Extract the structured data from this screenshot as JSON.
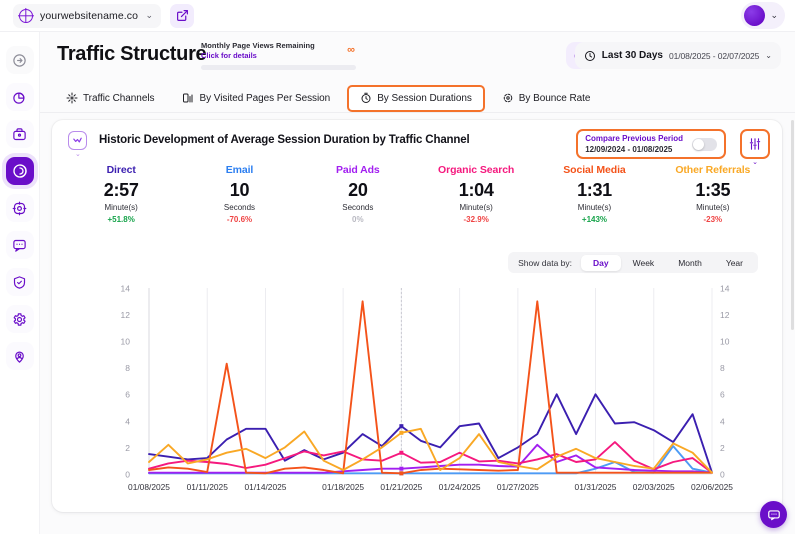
{
  "topbar": {
    "site_name": "yourwebsitename.co",
    "site_chevron": "⌄",
    "avatar_chevron": "⌄"
  },
  "sidebar": {
    "items": [
      {
        "name": "expand-panel",
        "icon": "arrow-right-circle-icon"
      },
      {
        "name": "dashboard",
        "icon": "pie-chart-icon"
      },
      {
        "name": "campaigns",
        "icon": "briefcase-icon"
      },
      {
        "name": "traffic",
        "icon": "traffic-icon",
        "active": true
      },
      {
        "name": "goals",
        "icon": "target-icon"
      },
      {
        "name": "messages",
        "icon": "chat-icon"
      },
      {
        "name": "security",
        "icon": "shield-check-icon"
      },
      {
        "name": "settings",
        "icon": "gear-icon"
      },
      {
        "name": "visitors",
        "icon": "user-location-icon"
      }
    ]
  },
  "header": {
    "title": "Traffic Structure",
    "quota_label": "Monthly Page Views Remaining",
    "quota_link": "Click for details",
    "quota_value": "∞",
    "refresh_icon": "refresh-icon",
    "date_icon": "clock-icon",
    "date_label": "Last 30 Days",
    "date_range": "01/08/2025 - 02/07/2025",
    "date_chevron": "⌄"
  },
  "tabs": [
    {
      "label": "Traffic Channels",
      "icon": "share-nodes-icon",
      "active": false
    },
    {
      "label": "By Visited Pages Per Session",
      "icon": "pages-icon",
      "active": false
    },
    {
      "label": "By Session Durations",
      "icon": "stopwatch-icon",
      "active": true,
      "highlighted": true
    },
    {
      "label": "By Bounce Rate",
      "icon": "bounce-icon",
      "active": false
    }
  ],
  "card": {
    "icon": "chart-box-icon",
    "icon_chevron": "⌄",
    "title": "Historic Development of Average Session Duration by Traffic Channel",
    "compare": {
      "label": "Compare Previous Period",
      "range": "12/09/2024 - 01/08/2025",
      "toggle_on": false
    },
    "filter_icon": "sliders-icon",
    "filter_chevron": "⌄"
  },
  "metrics": [
    {
      "name": "Direct",
      "value": "2:57",
      "unit": "Minute(s)",
      "delta": "+51.8%",
      "delta_dir": "up",
      "color": "#3b1fb0",
      "delta_color": "#16a34a"
    },
    {
      "name": "Email",
      "value": "10",
      "unit": "Seconds",
      "delta": "-70.6%",
      "delta_dir": "down",
      "color": "#2b7ef0",
      "delta_color": "#ef4444"
    },
    {
      "name": "Paid Ads",
      "value": "20",
      "unit": "Seconds",
      "delta": "0%",
      "delta_dir": "flat",
      "color": "#a21ff0",
      "delta_color": "#b9b9c2"
    },
    {
      "name": "Organic Search",
      "value": "1:04",
      "unit": "Minute(s)",
      "delta": "-32.9%",
      "delta_dir": "down",
      "color": "#f5197e",
      "delta_color": "#ef4444"
    },
    {
      "name": "Social Media",
      "value": "1:31",
      "unit": "Minute(s)",
      "delta": "+143%",
      "delta_dir": "up",
      "color": "#f4531a",
      "delta_color": "#16a34a"
    },
    {
      "name": "Other Referrals",
      "value": "1:35",
      "unit": "Minute(s)",
      "delta": "-23%",
      "delta_dir": "down",
      "color": "#f9a825",
      "delta_color": "#ef4444"
    }
  ],
  "showby": {
    "label": "Show data by:",
    "options": [
      "Day",
      "Week",
      "Month",
      "Year"
    ],
    "selected": "Day"
  },
  "chart_data": {
    "type": "line",
    "title": "Historic Development of Average Session Duration by Traffic Channel",
    "xlabel": "",
    "ylabel": "",
    "ylim": [
      0,
      14
    ],
    "yticks": [
      0,
      2,
      4,
      6,
      8,
      10,
      12,
      14
    ],
    "grid": "vertical-only",
    "legend": "top-metrics",
    "x": [
      "01/08/2025",
      "01/09/2025",
      "01/10/2025",
      "01/11/2025",
      "01/12/2025",
      "01/13/2025",
      "01/14/2025",
      "01/15/2025",
      "01/16/2025",
      "01/17/2025",
      "01/18/2025",
      "01/19/2025",
      "01/20/2025",
      "01/21/2025",
      "01/22/2025",
      "01/23/2025",
      "01/24/2025",
      "01/25/2025",
      "01/26/2025",
      "01/27/2025",
      "01/28/2025",
      "01/29/2025",
      "01/30/2025",
      "01/31/2025",
      "02/01/2025",
      "02/02/2025",
      "02/03/2025",
      "02/04/2025",
      "02/05/2025",
      "02/06/2025"
    ],
    "xtick_labels": [
      "01/08/2025",
      "01/11/2025",
      "01/14/2025",
      "01/18/2025",
      "01/21/2025",
      "01/24/2025",
      "01/27/2025",
      "01/31/2025",
      "02/03/2025",
      "02/06/2025"
    ],
    "series": [
      {
        "name": "Direct",
        "color": "#3b1fb0",
        "values": [
          1.5,
          1.3,
          1.1,
          1.2,
          2.6,
          3.4,
          3.4,
          1.0,
          1.8,
          1.1,
          1.6,
          3.0,
          2.1,
          3.6,
          2.5,
          2.0,
          3.6,
          3.8,
          1.2,
          2.0,
          3.0,
          6.0,
          3.0,
          6.0,
          3.8,
          3.9,
          3.3,
          2.4,
          4.5,
          0.1
        ]
      },
      {
        "name": "Email",
        "color": "#4d9bf5",
        "values": [
          0.05,
          0.05,
          0.05,
          0.05,
          0.05,
          0.05,
          0.05,
          0.05,
          0.05,
          0.05,
          0.05,
          0.05,
          0.05,
          0.05,
          0.05,
          0.05,
          0.05,
          0.05,
          0.05,
          0.05,
          0.05,
          0.05,
          0.05,
          0.4,
          0.9,
          0.15,
          0.1,
          2.1,
          0.4,
          0.1
        ]
      },
      {
        "name": "Paid Ads",
        "color": "#a21ff0",
        "values": [
          0.1,
          0.1,
          0.1,
          0.1,
          0.1,
          0.1,
          0.1,
          0.1,
          0.1,
          0.1,
          0.2,
          0.3,
          0.4,
          0.4,
          0.5,
          0.6,
          0.7,
          0.7,
          0.6,
          0.55,
          2.2,
          0.9,
          1.4,
          0.5,
          0.4,
          0.3,
          0.25,
          0.2,
          0.2,
          0.1
        ]
      },
      {
        "name": "Organic Search",
        "color": "#f5197e",
        "values": [
          0.4,
          0.8,
          1.0,
          0.9,
          0.75,
          0.45,
          0.7,
          1.2,
          1.7,
          1.4,
          1.7,
          1.1,
          1.0,
          1.6,
          0.85,
          0.9,
          1.6,
          0.95,
          1.0,
          0.8,
          1.1,
          1.5,
          0.9,
          1.1,
          2.4,
          1.0,
          0.35,
          0.9,
          1.2,
          0.1
        ]
      },
      {
        "name": "Social Media",
        "color": "#f4531a",
        "values": [
          0.3,
          0.5,
          0.4,
          0.15,
          8.3,
          0.1,
          0.05,
          0.4,
          0.5,
          0.3,
          0.05,
          13.0,
          0.1,
          0.05,
          0.3,
          0.4,
          0.35,
          0.3,
          0.25,
          0.3,
          13.0,
          0.1,
          0.1,
          0.1,
          0.1,
          0.1,
          0.1,
          0.1,
          0.1,
          0.1
        ]
      },
      {
        "name": "Other Referrals",
        "color": "#f9a825",
        "values": [
          0.9,
          2.2,
          0.8,
          1.1,
          1.6,
          1.9,
          1.2,
          2.0,
          3.2,
          1.0,
          0.3,
          1.1,
          2.0,
          3.1,
          3.4,
          0.3,
          1.2,
          3.0,
          0.9,
          0.6,
          0.35,
          1.3,
          1.9,
          1.2,
          0.9,
          0.6,
          0.4,
          2.3,
          1.6,
          0.1
        ]
      }
    ]
  },
  "chat": {
    "icon": "chat-support-icon"
  }
}
